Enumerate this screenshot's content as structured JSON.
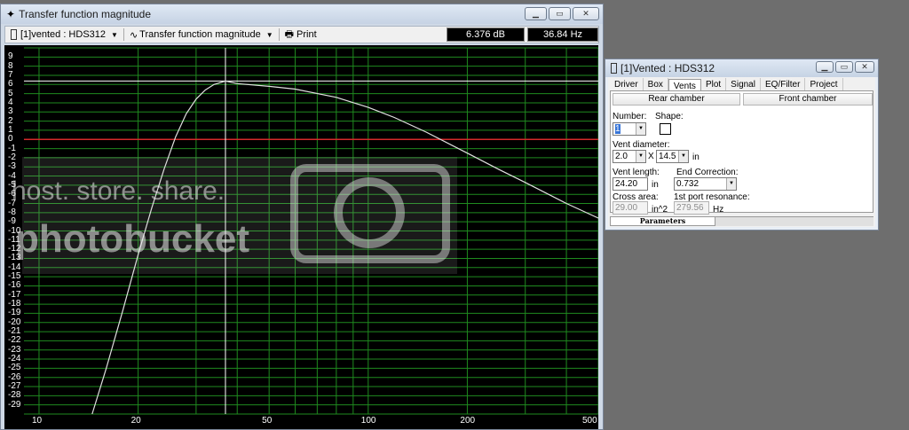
{
  "main_window": {
    "title": "Transfer function magnitude",
    "toolbar": {
      "project_select": "[1]vented : HDS312",
      "view_select": "Transfer function magnitude",
      "print_label": "Print"
    },
    "readout_db": "6.376 dB",
    "readout_hz": "36.84 Hz"
  },
  "chart_data": {
    "type": "line",
    "title": "",
    "xlabel": "",
    "ylabel": "",
    "x_scale": "log",
    "xlim": [
      9,
      500
    ],
    "ylim": [
      -30,
      10
    ],
    "grid": true,
    "x_tick_labels": [
      "10",
      "20",
      "50",
      "100",
      "200",
      "500"
    ],
    "y_tick_labels": [
      "9",
      "8",
      "7",
      "6",
      "5",
      "4",
      "3",
      "2",
      "1",
      "0",
      "-1",
      "-2",
      "-3",
      "-4",
      "-5",
      "-6",
      "-7",
      "-8",
      "-9",
      "-10",
      "-11",
      "-12",
      "-13",
      "-14",
      "-15",
      "-16",
      "-17",
      "-18",
      "-19",
      "-20",
      "-21",
      "-22",
      "-23",
      "-24",
      "-25",
      "-26",
      "-27",
      "-28",
      "-29"
    ],
    "reference_line_y": 0,
    "cursor": {
      "x": 36.84,
      "y": 6.376
    },
    "series": [
      {
        "x": [
          14.5,
          16,
          18,
          20,
          22,
          24,
          26,
          28,
          30,
          32,
          34,
          36.84,
          40,
          50,
          60,
          80,
          100,
          120,
          150,
          200,
          250,
          300,
          400,
          500
        ],
        "y": [
          -30,
          -25,
          -18.6,
          -12.6,
          -7.5,
          -3.2,
          0.3,
          2.8,
          4.4,
          5.4,
          6.0,
          6.376,
          6.1,
          5.8,
          5.5,
          4.6,
          3.5,
          2.4,
          0.8,
          -1.5,
          -3.3,
          -4.7,
          -7.0,
          -8.6
        ]
      }
    ],
    "colors": {
      "background": "#000000",
      "grid": "#1f8a1f",
      "curve": "#e0e0e0",
      "zero_line": "#d42a2a",
      "cursor": "#ffffff"
    }
  },
  "watermark": {
    "line1": "host. store. share.",
    "line2": "photobucket"
  },
  "vented_window": {
    "title": "[1]Vented : HDS312",
    "tabs": [
      "Driver",
      "Box",
      "Vents",
      "Plot",
      "Signal",
      "EQ/Filter",
      "Project"
    ],
    "active_tab": "Vents",
    "sections": {
      "rear": "Rear chamber",
      "front": "Front chamber"
    },
    "labels": {
      "number": "Number:",
      "shape": "Shape:",
      "vent_diameter": "Vent diameter:",
      "x": "X",
      "in": "in",
      "vent_length": "Vent length:",
      "end_correction": "End Correction:",
      "cross_area": "Cross area:",
      "port_resonance": "1st port resonance:",
      "in2": "in^2",
      "hz": "Hz"
    },
    "values": {
      "number": "1",
      "vent_diameter": "2.0",
      "vent_count": "14.5",
      "vent_length": "24.20",
      "end_correction": "0.732",
      "cross_area": "29.00",
      "port_resonance": "279.56"
    },
    "bottom_tabs": [
      "Parameters"
    ]
  }
}
